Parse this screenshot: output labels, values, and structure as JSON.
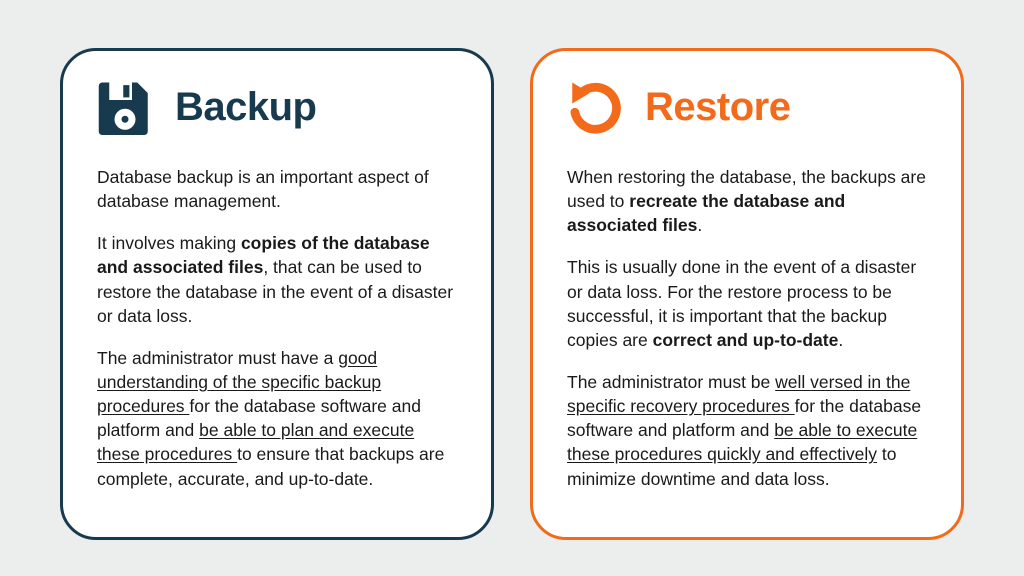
{
  "backup": {
    "title": "Backup",
    "p1_text": "Database backup is an important aspect of database management.",
    "p2_pre": "It involves making ",
    "p2_bold": "copies of the database and associated files",
    "p2_post": ", that can be used to restore the database in the event of a disaster or data loss.",
    "p3_pre": "The administrator must have a ",
    "p3_u1": "good understanding of the specific backup procedures ",
    "p3_mid": "for the database software and platform and ",
    "p3_u2": "be able to plan and execute these procedures ",
    "p3_post": "to ensure that backups are complete, accurate, and up-to-date."
  },
  "restore": {
    "title": "Restore",
    "p1_pre": "When restoring the database, the backups are used to ",
    "p1_bold": "recreate the database and associated files",
    "p1_post": ".",
    "p2_pre": "This is usually done in the event of a disaster or data loss. For the restore process to be successful, it is important that the backup copies are ",
    "p2_bold": "correct and up-to-date",
    "p2_post": ".",
    "p3_pre": "The administrator must be ",
    "p3_u1": "well versed in the specific recovery procedures ",
    "p3_mid": "for the database software and platform and ",
    "p3_u2": "be able to execute these procedures quickly and effectively",
    "p3_post": " to minimize downtime and data loss."
  }
}
